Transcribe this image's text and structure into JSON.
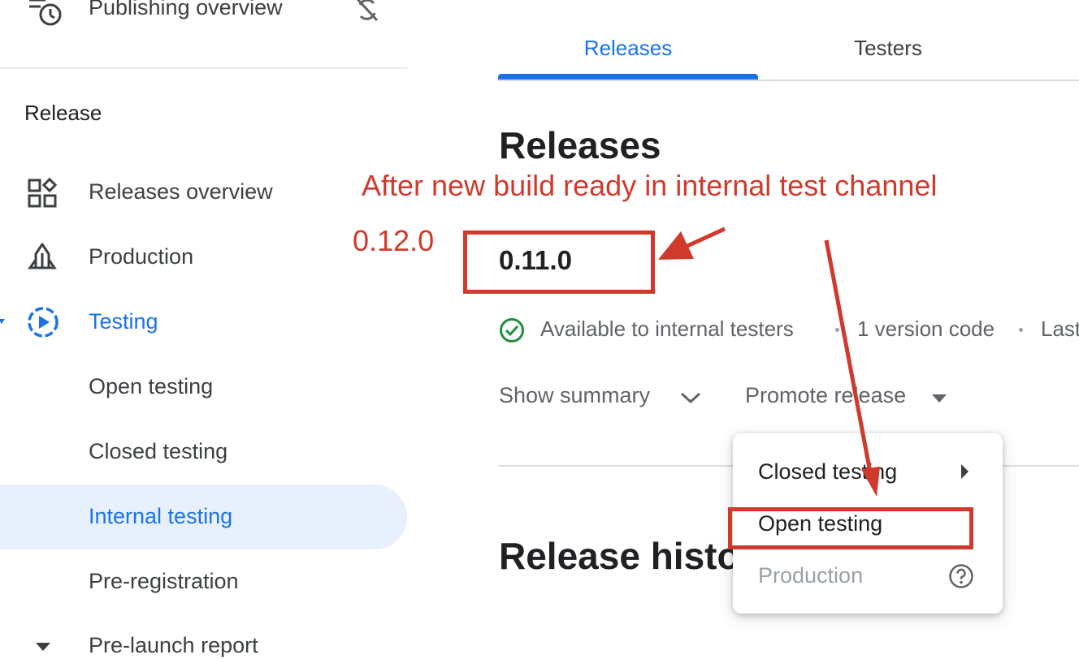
{
  "sidebar": {
    "top_item": {
      "label": "Publishing overview",
      "icon": "schedule-list-icon",
      "right_icon": "sync-off-icon"
    },
    "section_title": "Release",
    "items": [
      {
        "label": "Releases overview",
        "icon": "dashboard-icon"
      },
      {
        "label": "Production",
        "icon": "rocket-icon"
      },
      {
        "label": "Testing",
        "icon": "play-circle-icon",
        "active": true
      },
      {
        "label": "Open testing"
      },
      {
        "label": "Closed testing"
      },
      {
        "label": "Internal testing",
        "selected": true
      },
      {
        "label": "Pre-registration"
      },
      {
        "label": "Pre-launch report",
        "icon": "caret-down-icon"
      }
    ]
  },
  "tabs": [
    {
      "label": "Releases",
      "active": true
    },
    {
      "label": "Testers",
      "active": false
    }
  ],
  "main": {
    "title": "Releases",
    "release_version": "0.11.0",
    "status": {
      "available": "Available to internal testers",
      "version_codes": "1 version code",
      "last": "Last"
    },
    "show_summary": "Show summary",
    "promote_release": "Promote release",
    "history_title": "Release histo"
  },
  "menu": {
    "items": [
      {
        "label": "Closed testing",
        "submenu": true
      },
      {
        "label": "Open testing"
      },
      {
        "label": "Production",
        "disabled": true,
        "icon": "help-circle-icon"
      }
    ]
  },
  "annotations": {
    "note": "After new build ready in internal test channel",
    "new_version": "0.12.0",
    "color": "#d03a2c"
  },
  "colors": {
    "accent": "#1a73e8",
    "selected_bg": "#e8f0fe",
    "success": "#1e8e3e"
  }
}
